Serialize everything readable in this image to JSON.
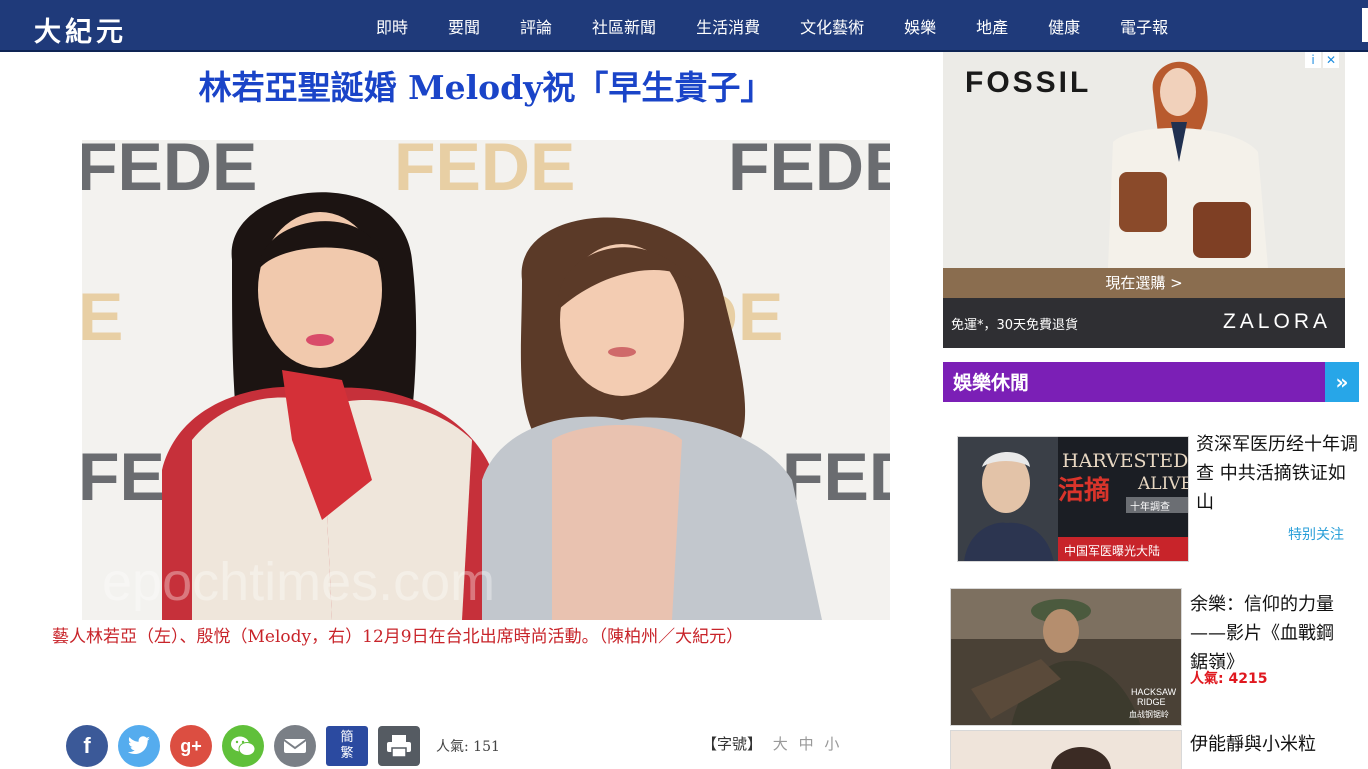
{
  "site": {
    "logo": "大紀元"
  },
  "nav": [
    "即時",
    "要聞",
    "評論",
    "社區新聞",
    "生活消費",
    "文化藝術",
    "娛樂",
    "地產",
    "健康",
    "電子報"
  ],
  "article": {
    "title": "林若亞聖誕婚 Melody祝「早生貴子」",
    "photo_backdrop_text": "FEDE",
    "photo_watermark": "epochtimes.com",
    "caption": "藝人林若亞（左）、殷悅（Melody，右）12月9日在台北出席時尚活動。（陳柏州／大紀元）",
    "share": {
      "facebook": "f",
      "google": "g+",
      "trad_simp": [
        "簡",
        "繁"
      ],
      "popularity": "人氣: 151"
    },
    "font_size": {
      "label": "【字號】",
      "options": [
        "大",
        "中",
        "小"
      ]
    }
  },
  "ad": {
    "brand": "FOSSIL",
    "cta": "現在選購 >",
    "note": "免運*，30天免費退貨",
    "partner": "ZALORA",
    "adchoices": [
      "i",
      "✕"
    ]
  },
  "sidebar": {
    "section_title": "娛樂休閒",
    "section_more": "»",
    "items": [
      {
        "title": "资深军医历经十年调查 中共活摘铁证如山",
        "tag": "特别关注",
        "thumb_text": [
          "HARVESTED",
          "活摘",
          "ALIVE",
          "十年調查",
          "中国军医曝光大陆"
        ]
      },
      {
        "title": "余樂：信仰的力量——影片《血戰鋼鋸嶺》",
        "popularity": "人氣: 4215",
        "thumb_text": [
          "HACKSAW",
          "RIDGE",
          "血战钢锯岭"
        ]
      },
      {
        "title": "伊能靜與小米粒"
      }
    ]
  },
  "colors": {
    "nav_bg": "#1f3a7a",
    "headline": "#1a44c8",
    "caption": "#c8242a",
    "section_bg": "#7b1fb6",
    "section_more": "#27a6e8",
    "popularity": "#e0181f",
    "tag": "#2a9fd8"
  }
}
